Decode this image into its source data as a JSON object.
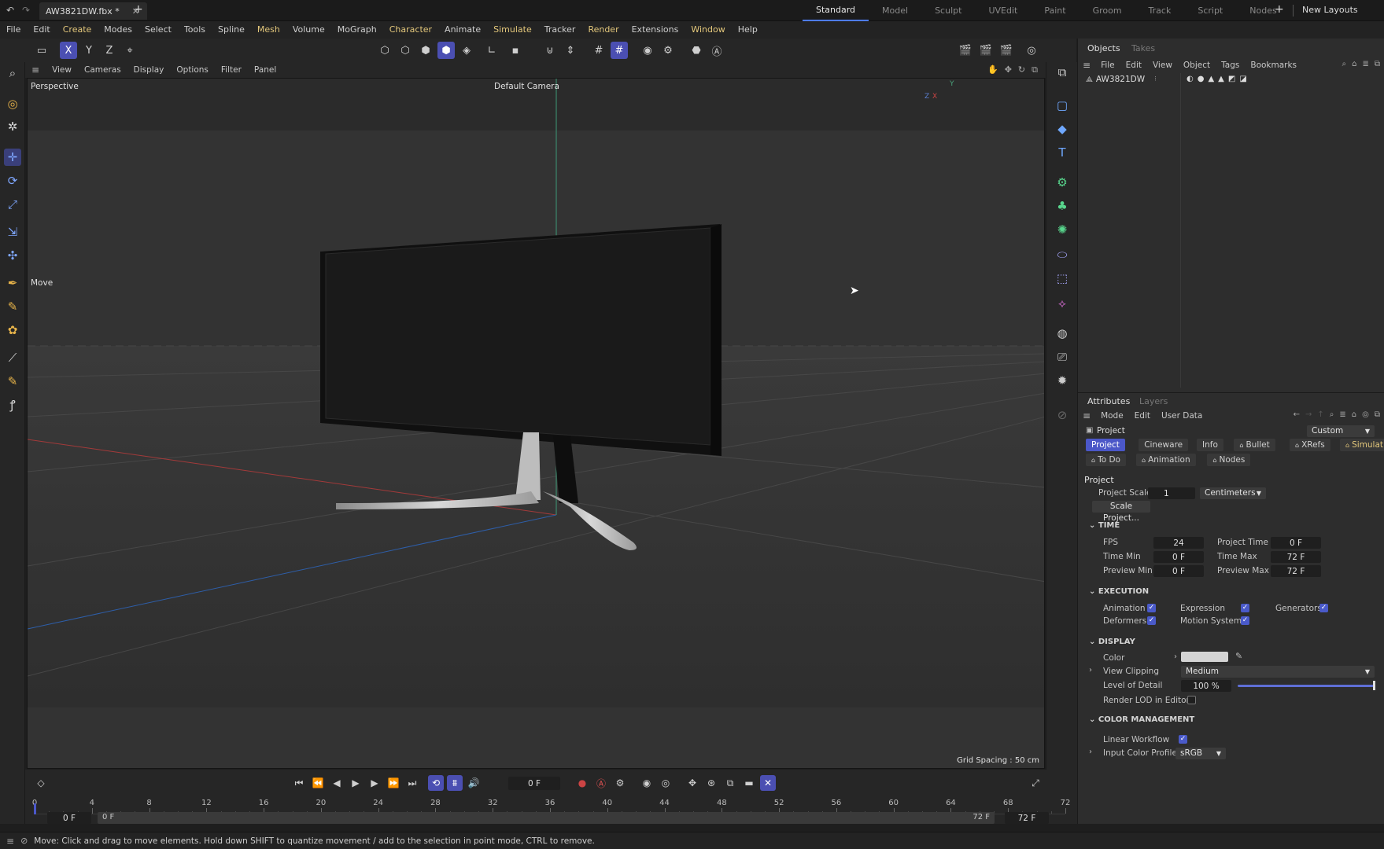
{
  "title_bar": {
    "file_tab": "AW3821DW.fbx *",
    "layouts": [
      "Standard",
      "Model",
      "Sculpt",
      "UVEdit",
      "Paint",
      "Groom",
      "Track",
      "Script",
      "Nodes"
    ],
    "active_layout": "Standard",
    "new_layouts": "New Layouts"
  },
  "menu": [
    "File",
    "Edit",
    "Create",
    "Modes",
    "Select",
    "Tools",
    "Spline",
    "Mesh",
    "Volume",
    "MoGraph",
    "Character",
    "Animate",
    "Simulate",
    "Tracker",
    "Render",
    "Extensions",
    "Window",
    "Help"
  ],
  "toolbar_axes": [
    "X",
    "Y",
    "Z"
  ],
  "viewport": {
    "menu": [
      "View",
      "Cameras",
      "Display",
      "Options",
      "Filter",
      "Panel"
    ],
    "projection": "Perspective",
    "camera": "Default Camera",
    "tool_label": "Move",
    "grid_spacing": "Grid Spacing : 50 cm",
    "axis_y": "Y",
    "axis_x": "X",
    "axis_z": "Z"
  },
  "objects_panel": {
    "tabs": [
      "Objects",
      "Takes"
    ],
    "menu": [
      "File",
      "Edit",
      "View",
      "Object",
      "Tags",
      "Bookmarks"
    ],
    "object_name": "AW3821DW"
  },
  "attributes_panel": {
    "tabs": [
      "Attributes",
      "Layers"
    ],
    "menu": [
      "Mode",
      "Edit",
      "User Data"
    ],
    "mode_title": "Project",
    "preset": "Custom",
    "subtabs_row1": [
      "Project",
      "Cineware",
      "Info",
      "Bullet",
      "XRefs",
      "Simulation"
    ],
    "subtabs_row2": [
      "To Do",
      "Animation",
      "Nodes"
    ],
    "section_project": "Project",
    "project_scale_label": "Project Scale",
    "project_scale_value": "1",
    "project_scale_unit": "Centimeters",
    "scale_project_button": "Scale Project...",
    "time": {
      "header": "TIME",
      "fps_label": "FPS",
      "fps": "24",
      "project_time_label": "Project Time",
      "project_time": "0 F",
      "time_min_label": "Time Min",
      "time_min": "0 F",
      "time_max_label": "Time Max",
      "time_max": "72 F",
      "preview_min_label": "Preview Min",
      "preview_min": "0 F",
      "preview_max_label": "Preview Max",
      "preview_max": "72 F"
    },
    "execution": {
      "header": "EXECUTION",
      "animation": "Animation",
      "expression": "Expression",
      "generators": "Generators",
      "deformers": "Deformers",
      "motion_system": "Motion System"
    },
    "display": {
      "header": "DISPLAY",
      "color_label": "Color",
      "view_clipping_label": "View Clipping",
      "view_clipping": "Medium",
      "lod_label": "Level of Detail",
      "lod": "100 %",
      "lod_fraction": 1.0,
      "render_lod_label": "Render LOD in Editor"
    },
    "color_management": {
      "header": "COLOR MANAGEMENT",
      "linear_workflow": "Linear Workflow",
      "input_profile_label": "Input Color Profile",
      "input_profile": "sRGB"
    }
  },
  "timeline": {
    "current_frame": "0 F",
    "ruler": [
      "0",
      "4",
      "8",
      "12",
      "16",
      "20",
      "24",
      "28",
      "32",
      "36",
      "40",
      "44",
      "48",
      "52",
      "56",
      "60",
      "64",
      "68",
      "72"
    ],
    "start_field": "0 F",
    "range_start": "0 F",
    "range_end": "72 F",
    "end_field": "72 F"
  },
  "status": "Move: Click and drag to move elements. Hold down SHIFT to quantize movement / add to the selection in point mode, CTRL to remove.",
  "colors": {
    "accent": "#4b57c8",
    "menu_highlight": "#e3c77b",
    "viewport_bg": "#303030"
  }
}
